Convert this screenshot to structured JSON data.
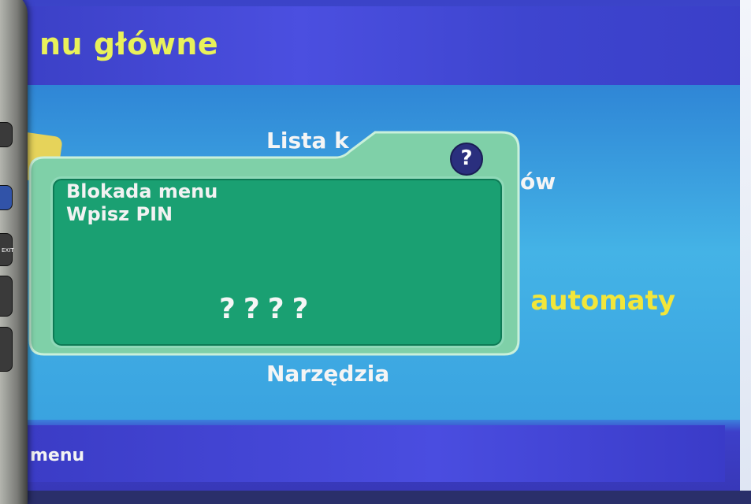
{
  "screen": {
    "title": "nu główne",
    "footer": "menu"
  },
  "menu": {
    "item_top": "Lista k",
    "item_right_fragment": "ów",
    "item_highlight": ": automaty",
    "item_bottom": "Narzędzia"
  },
  "dialog": {
    "line1": "Blokada menu",
    "line2": "Wpisz PIN",
    "pin": "????",
    "help_icon": "?"
  },
  "remote": {
    "exit_label": "EXIT"
  },
  "colors": {
    "title": "#e9f15a",
    "highlight": "#f2e63a",
    "dialog": "#1aa072",
    "help_icon": "#2a2f7e"
  }
}
